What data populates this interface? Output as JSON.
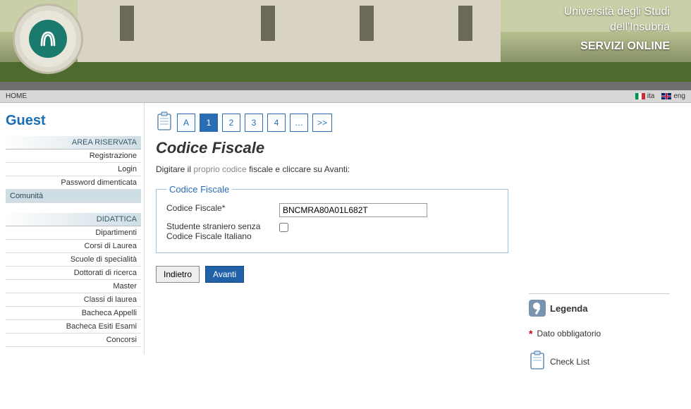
{
  "header": {
    "university_line1": "Università degli Studi",
    "university_line2": "dell'Insubria",
    "service": "SERVIZI ONLINE"
  },
  "topbar": {
    "home": "HOME",
    "lang_ita": "ita",
    "lang_eng": "eng"
  },
  "sidebar": {
    "user": "Guest",
    "section_area": "AREA RISERVATA",
    "items_area": [
      "Registrazione",
      "Login",
      "Password dimenticata"
    ],
    "community": "Comunità",
    "section_didattica": "DIDATTICA",
    "items_didattica": [
      "Dipartimenti",
      "Corsi di Laurea",
      "Scuole di specialità",
      "Dottorati di ricerca",
      "Master",
      "Classi di laurea",
      "Bacheca Appelli",
      "Bacheca Esiti Esami",
      "Concorsi"
    ]
  },
  "stepper": {
    "labelA": "A",
    "steps": [
      "1",
      "2",
      "3",
      "4",
      "…",
      ">>"
    ]
  },
  "page": {
    "title": "Codice Fiscale",
    "intro_pre": "Digitare il ",
    "intro_grey": "proprio codice",
    "intro_post": " fiscale e cliccare su Avanti:"
  },
  "form": {
    "legend": "Codice Fiscale",
    "field_cf_label": "Codice Fiscale*",
    "field_cf_value": "BNCMRA80A01L682T",
    "field_foreign_label": "Studente straniero senza Codice Fiscale Italiano"
  },
  "buttons": {
    "back": "Indietro",
    "next": "Avanti"
  },
  "legend_box": {
    "title": "Legenda",
    "mandatory": "Dato obbligatorio",
    "checklist": "Check List"
  }
}
